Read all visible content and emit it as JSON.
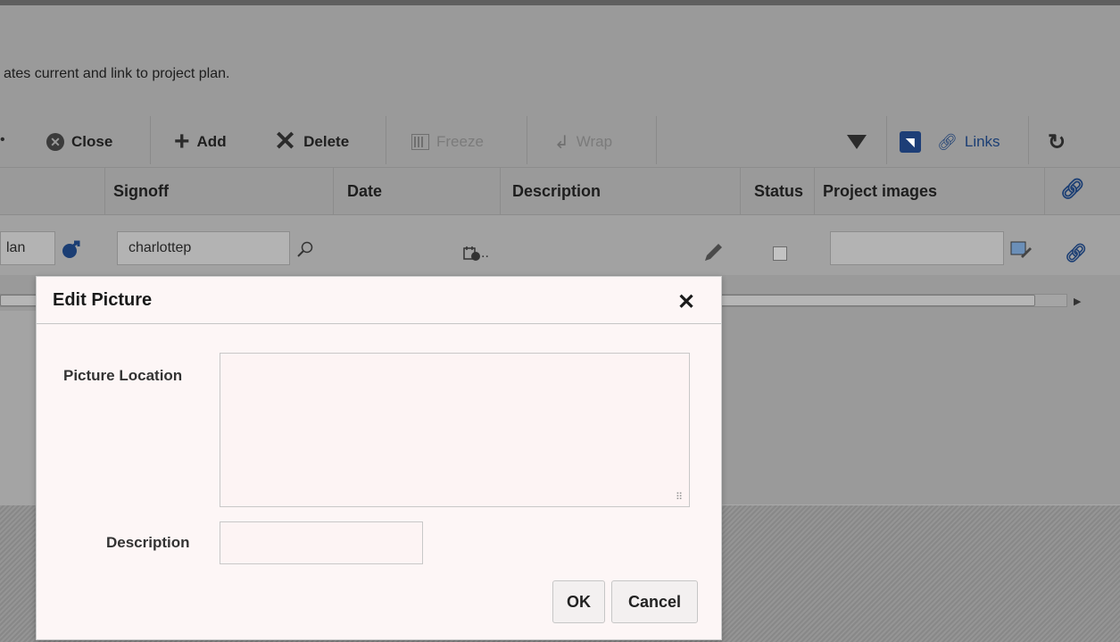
{
  "intro_text": "ates current and link to project plan.",
  "toolbar": {
    "ellipsis": "•",
    "close_label": "Close",
    "add_label": "Add",
    "delete_label": "Delete",
    "freeze_label": "Freeze",
    "wrap_label": "Wrap",
    "links_label": "Links"
  },
  "table": {
    "headers": {
      "signoff": "Signoff",
      "date": "Date",
      "description": "Description",
      "status": "Status",
      "project_images": "Project images"
    },
    "row": {
      "plan": "lan",
      "signoff": "charlottep",
      "date_trail": ".."
    }
  },
  "dialog": {
    "title": "Edit Picture",
    "close_glyph": "✕",
    "picture_location_label": "Picture Location",
    "picture_location_value": "",
    "description_label": "Description",
    "description_value": "",
    "ok_label": "OK",
    "cancel_label": "Cancel"
  },
  "colors": {
    "overlay": "#9a9a9a",
    "dialog_bg": "#fdf6f6",
    "link_blue": "#1b3e74"
  }
}
